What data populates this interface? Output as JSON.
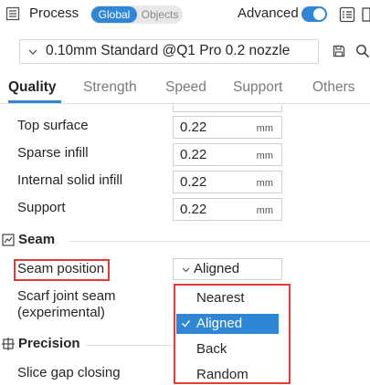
{
  "header": {
    "title": "Process",
    "scope_global": "Global",
    "scope_objects": "Objects",
    "advanced_label": "Advanced",
    "advanced_on": true
  },
  "preset": {
    "name": "0.10mm Standard @Q1 Pro 0.2 nozzle"
  },
  "tabs": [
    {
      "label": "Quality",
      "active": true
    },
    {
      "label": "Strength",
      "active": false
    },
    {
      "label": "Speed",
      "active": false
    },
    {
      "label": "Support",
      "active": false
    },
    {
      "label": "Others",
      "active": false
    }
  ],
  "quality_rows": [
    {
      "label": "Top surface",
      "value": "0.22",
      "unit": "mm"
    },
    {
      "label": "Sparse infill",
      "value": "0.22",
      "unit": "mm"
    },
    {
      "label": "Internal solid infill",
      "value": "0.22",
      "unit": "mm"
    },
    {
      "label": "Support",
      "value": "0.22",
      "unit": "mm"
    }
  ],
  "seam": {
    "title": "Seam",
    "position_label": "Seam position",
    "position_value": "Aligned",
    "scarf_label_line1": "Scarf joint seam",
    "scarf_label_line2": "(experimental)",
    "options": [
      "Nearest",
      "Aligned",
      "Back",
      "Random"
    ],
    "selected_option": "Aligned"
  },
  "precision": {
    "title": "Precision",
    "slice_gap_label": "Slice gap closing"
  },
  "colors": {
    "accent": "#2f86d6",
    "highlight": "#e53935"
  }
}
